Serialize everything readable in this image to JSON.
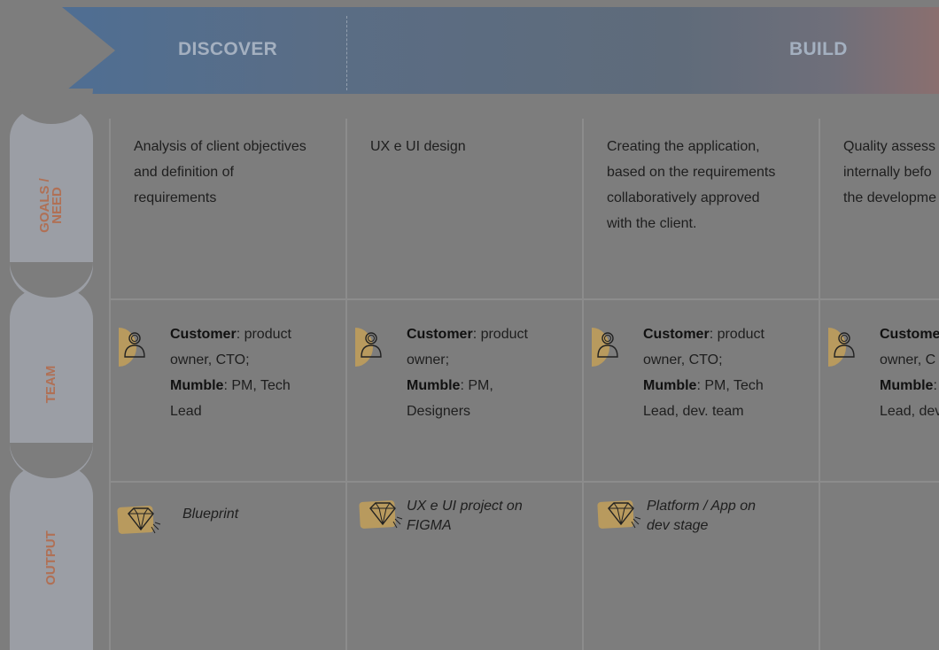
{
  "phases": {
    "discover": "DISCOVER",
    "build": "BUILD"
  },
  "rows": {
    "goals": "GOALS / NEED",
    "goals_line1": "GOALS /",
    "goals_line2": "NEED",
    "team": "TEAM",
    "output": "OUTPUT"
  },
  "goals": [
    {
      "lines": [
        "Analysis of client objectives",
        "and definition of",
        "requirements"
      ]
    },
    {
      "lines": [
        "UX e UI design"
      ]
    },
    {
      "lines": [
        "Creating the application,",
        "based on the requirements",
        "collaboratively approved",
        "with the client."
      ]
    },
    {
      "lines": [
        "Quality assess",
        "internally befo",
        "the developme"
      ]
    }
  ],
  "team": [
    {
      "customer_label": "Customer",
      "customer_l1": ": product",
      "customer_l2": "owner, CTO;",
      "mumble_label": "Mumble",
      "mumble_l1": ": PM, Tech",
      "mumble_l2": "Lead"
    },
    {
      "customer_label": "Customer",
      "customer_l1": ": product",
      "customer_l2": "owner;",
      "mumble_label": "Mumble",
      "mumble_l1": ": PM,",
      "mumble_l2": "Designers"
    },
    {
      "customer_label": "Customer",
      "customer_l1": ": product",
      "customer_l2": "owner, CTO;",
      "mumble_label": "Mumble",
      "mumble_l1": ": PM, Tech",
      "mumble_l2": "Lead, dev. team"
    },
    {
      "customer_label": "Custome",
      "customer_l1": "",
      "customer_l2": "owner, C",
      "mumble_label": "Mumble",
      "mumble_l1": ":",
      "mumble_l2": "Lead, dev"
    }
  ],
  "output": [
    {
      "l1": "Blueprint",
      "l2": ""
    },
    {
      "l1": "UX e UI project on",
      "l2": "FIGMA"
    },
    {
      "l1": "Platform / App on",
      "l2": "dev stage"
    }
  ],
  "colors": {
    "background": "#7d7d7d",
    "band_start": "#4f6e93",
    "tab": "#9b9ea5",
    "row_label": "#b07055",
    "icon_accent": "#b89a5e"
  }
}
